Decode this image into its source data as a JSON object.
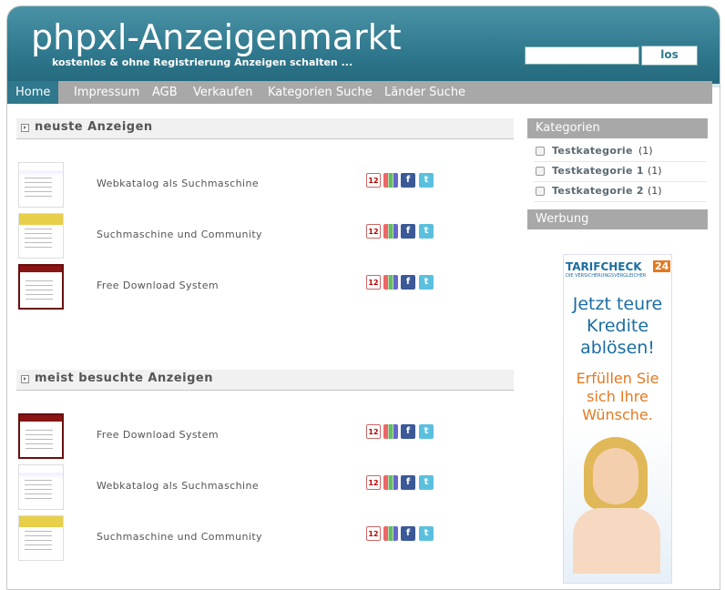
{
  "header": {
    "title": "phpxl-Anzeigenmarkt",
    "subtitle": "kostenlos & ohne Registrierung Anzeigen schalten ...",
    "search": {
      "placeholder": "",
      "button_label": "los"
    }
  },
  "nav": {
    "items": [
      "Home",
      "Impressum",
      "AGB",
      "Verkaufen",
      "Kategorien Suche",
      "Länder Suche"
    ],
    "active": "Home"
  },
  "sections": {
    "newest": {
      "title": "neuste Anzeigen",
      "items": [
        {
          "title": "Webkatalog als Suchmaschine",
          "thumb": "blue"
        },
        {
          "title": "Suchmaschine und Community",
          "thumb": "yellow"
        },
        {
          "title": "Free Download System",
          "thumb": "red"
        }
      ]
    },
    "most_visited": {
      "title": "meist besuchte Anzeigen",
      "items": [
        {
          "title": "Free Download System",
          "thumb": "red"
        },
        {
          "title": "Webkatalog als Suchmaschine",
          "thumb": "blue"
        },
        {
          "title": "Suchmaschine und Community",
          "thumb": "yellow"
        }
      ]
    }
  },
  "share_icons": {
    "calendar": "12",
    "facebook": "f",
    "twitter": "t"
  },
  "sidebar": {
    "categories_title": "Kategorien",
    "categories": [
      {
        "label": "Testkategorie",
        "count": "(1)"
      },
      {
        "label": "Testkategorie 1",
        "count": "(1)"
      },
      {
        "label": "Testkategorie 2",
        "count": "(1)"
      }
    ],
    "ads_title": "Werbung"
  },
  "ad": {
    "logo": "TARIFCHECK",
    "logo_num": "24",
    "logo_sub": "DIE VERSICHERUNGSVERGLEICHER",
    "headline": "Jetzt teure Kredite ablösen!",
    "subline": "Erfüllen Sie sich Ihre Wünsche."
  },
  "colors": {
    "brand": "#2f788d",
    "nav": "#a8a8a8",
    "ad_blue": "#1b6da1",
    "ad_orange": "#e37a21"
  }
}
